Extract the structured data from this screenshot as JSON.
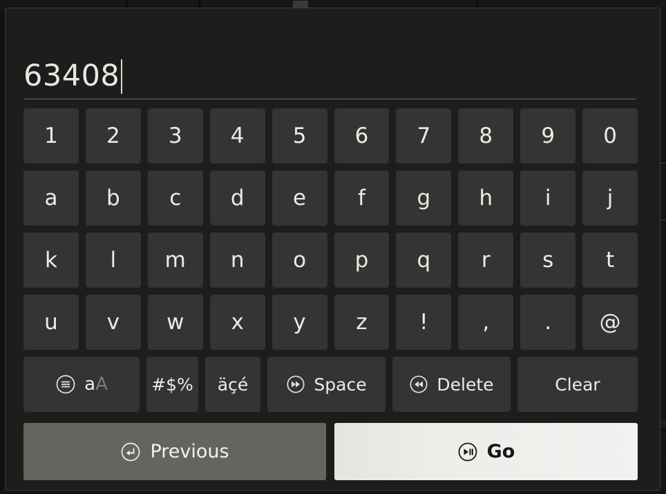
{
  "screen": {
    "type": "on-screen-keyboard-overlay",
    "background_color": "#1d1d1b",
    "key_color": "#343432",
    "key_text_color": "#ebebe7"
  },
  "text_field": {
    "value": "63408",
    "placeholder": "",
    "caret_visible": true
  },
  "keyboard": {
    "rows": [
      {
        "name": "digits",
        "keys": [
          "1",
          "2",
          "3",
          "4",
          "5",
          "6",
          "7",
          "8",
          "9",
          "0"
        ]
      },
      {
        "name": "letters1",
        "keys": [
          "a",
          "b",
          "c",
          "d",
          "e",
          "f",
          "g",
          "h",
          "i",
          "j"
        ]
      },
      {
        "name": "letters2",
        "keys": [
          "k",
          "l",
          "m",
          "n",
          "o",
          "p",
          "q",
          "r",
          "s",
          "t"
        ]
      },
      {
        "name": "letters3",
        "keys": [
          "u",
          "v",
          "w",
          "x",
          "y",
          "z",
          "!",
          ",",
          ".",
          "@"
        ]
      }
    ],
    "function_row": {
      "case_toggle": {
        "icon": "menu-circle-icon",
        "label_active": "a",
        "label_inactive": "A"
      },
      "symbols": {
        "label": "#$%"
      },
      "accents": {
        "label": "äçé"
      },
      "space": {
        "icon": "fast-forward-circle-icon",
        "label": "Space"
      },
      "delete": {
        "icon": "rewind-circle-icon",
        "label": "Delete"
      },
      "clear": {
        "label": "Clear"
      }
    }
  },
  "actions": {
    "previous": {
      "icon": "back-arrow-circle-icon",
      "label": "Previous",
      "color": "#65655f"
    },
    "go": {
      "icon": "play-pause-circle-icon",
      "label": "Go",
      "color": "#ededea"
    }
  }
}
